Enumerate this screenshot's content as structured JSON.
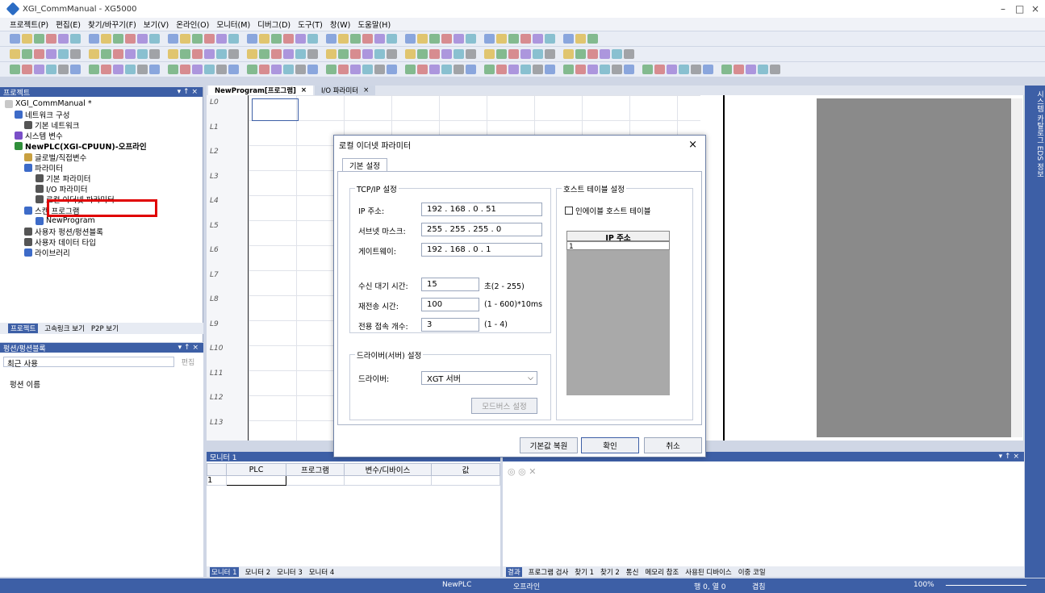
{
  "window": {
    "title": "XGI_CommManual - XG5000",
    "controls": [
      "–",
      "□",
      "×"
    ]
  },
  "menu": [
    "프로젝트(P)",
    "편집(E)",
    "찾기/바꾸기(F)",
    "보기(V)",
    "온라인(O)",
    "모니터(M)",
    "디버그(D)",
    "도구(T)",
    "창(W)",
    "도움말(H)"
  ],
  "project_panel": {
    "title": "프로젝트",
    "pin": "▾ ↑ ×",
    "tree": [
      {
        "label": "XGI_CommManual *",
        "bold": false
      },
      {
        "label": "네트워크 구성",
        "bold": false
      },
      {
        "label": "기본 네트워크",
        "bold": false
      },
      {
        "label": "시스템 변수",
        "bold": false
      },
      {
        "label": "NewPLC(XGI-CPUUN)-오프라인",
        "bold": true
      },
      {
        "label": "글로벌/직접변수",
        "bold": false
      },
      {
        "label": "파라미터",
        "bold": false
      },
      {
        "label": "기본 파라미터",
        "bold": false
      },
      {
        "label": "I/O 파라미터",
        "bold": false
      },
      {
        "label": "로컬 이더넷 파라미터",
        "bold": false
      },
      {
        "label": "스캔 프로그램",
        "bold": false
      },
      {
        "label": "NewProgram",
        "bold": false
      },
      {
        "label": "사용자 펑션/펑션블록",
        "bold": false
      },
      {
        "label": "사용자 데이터 타입",
        "bold": false
      },
      {
        "label": "라이브러리",
        "bold": false
      }
    ],
    "tabs": [
      "프로젝트",
      "고속링크 보기",
      "P2P 보기"
    ]
  },
  "function_panel": {
    "title": "펑션/펑션블록",
    "combo": "최근 사용",
    "edit": "편집",
    "label": "펑션 이름"
  },
  "doc_tabs": [
    {
      "label": "NewProgram[프로그램]"
    },
    {
      "label": "I/O 파라미터"
    }
  ],
  "rungs": [
    "L0",
    "L1",
    "L2",
    "L3",
    "L4",
    "L5",
    "L6",
    "L7",
    "L8",
    "L9",
    "L10",
    "L11",
    "L12",
    "L13"
  ],
  "side_panel": "시스템 카탈로그  EDS 정보",
  "dialog": {
    "title": "로컬 이더넷 파라미터",
    "tab": "기본 설정",
    "tcpip": {
      "title": "TCP/IP 설정",
      "ip_label": "IP 주소:",
      "ip": "192  .  168  .   0   .  51",
      "mask_label": "서브넷 마스크:",
      "mask": "255  .  255  .  255  .   0",
      "gw_label": "게이트웨이:",
      "gw": "192  .  168  .   0   .   1",
      "recv_label": "수신 대기 시간:",
      "recv": "15",
      "recv_hint": "초(2 - 255)",
      "retx_label": "재전송 시간:",
      "retx": "100",
      "retx_hint": "(1 - 600)*10ms",
      "conn_label": "전용 접속 개수:",
      "conn": "3",
      "conn_hint": "(1 - 4)"
    },
    "driver": {
      "title": "드라이버(서버) 설정",
      "label": "드라이버:",
      "value": "XGT 서버",
      "modbus_button": "모드버스 설정"
    },
    "host": {
      "title": "호스트 테이블 설정",
      "checkbox": "인에이블 호스트 테이블",
      "col": "IP 주소",
      "row1": "1"
    },
    "buttons": {
      "reset": "기본값 복원",
      "ok": "확인",
      "cancel": "취소"
    }
  },
  "monitor": {
    "title": "모니터 1",
    "cols": [
      "PLC",
      "프로그램",
      "변수/디바이스",
      "값"
    ],
    "row1": "1",
    "tabs": [
      "모니터 1",
      "모니터 2",
      "모니터 3",
      "모니터 4"
    ]
  },
  "results": {
    "tabs": [
      "결과",
      "프로그램 검사",
      "찾기 1",
      "찾기 2",
      "통신",
      "메모리 참조",
      "사용된 디바이스",
      "이중 코일"
    ]
  },
  "status": {
    "plc": "NewPLC",
    "mode": "오프라인",
    "pos": "행 0, 열 0",
    "ovr": "겹침",
    "zoom": "100%"
  }
}
